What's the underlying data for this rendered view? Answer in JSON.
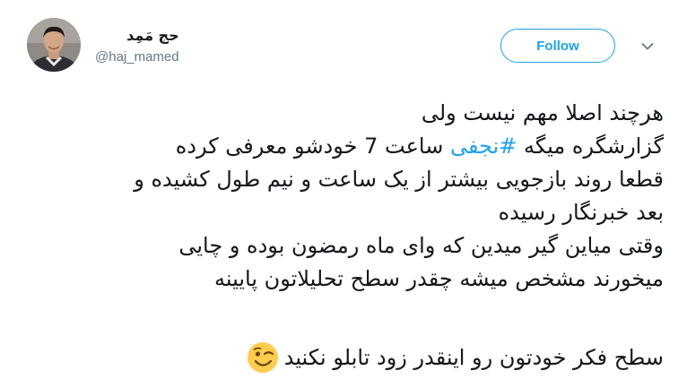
{
  "author": {
    "display_name": "حج مَمِد",
    "handle": "@haj_mamed"
  },
  "actions": {
    "follow_label": "Follow",
    "menu_icon": "chevron-down-icon"
  },
  "tweet": {
    "lines": [
      "هرچند اصلا مهم نیست ولی",
      "ساعت 7 خودشو معرفی کرده",
      "قطعا روند بازجویی بیشتر از یک ساعت و نیم طول کشیده و",
      "بعد خبرنگار رسیده",
      "وقتی میاین گیر میدین که وای ماه رمضون بوده و چایی",
      "میخورند مشخص میشه چقدر سطح تحلیلاتون پایینه",
      "سطح فکر خودتون رو اینقدر زود تابلو نکنید"
    ],
    "line2_prefix": "گزارشگره میگه",
    "hashtag": "#نجفی",
    "emoji": "winking-face-icon"
  },
  "colors": {
    "accent": "#1da1f2",
    "text": "#14171a",
    "muted": "#657786"
  }
}
